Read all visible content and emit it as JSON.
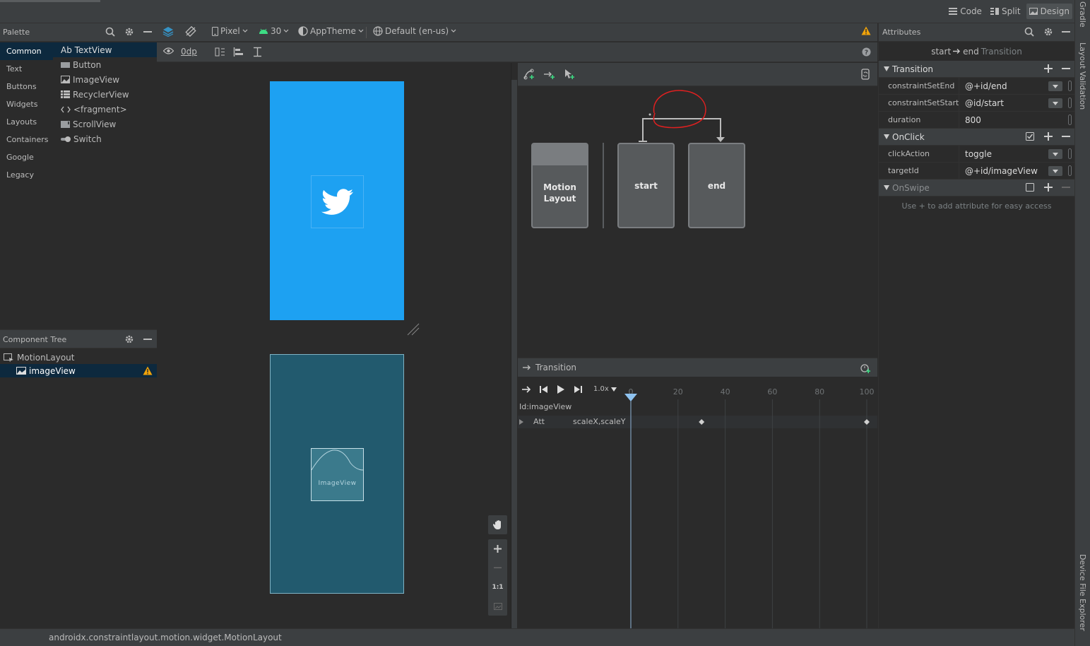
{
  "view_modes": [
    {
      "label": "Code",
      "icon": "lines-icon"
    },
    {
      "label": "Split",
      "icon": "split-icon"
    },
    {
      "label": "Design",
      "icon": "image-icon",
      "active": true
    }
  ],
  "right_stripe": {
    "gradle": "Gradle",
    "layout_validation": "Layout Validation",
    "device_file_explorer": "Device File Explorer"
  },
  "palette": {
    "title": "Palette",
    "categories": [
      "Common",
      "Text",
      "Buttons",
      "Widgets",
      "Layouts",
      "Containers",
      "Google",
      "Legacy"
    ],
    "active_category": "Common",
    "items": [
      "Ab TextView",
      "Button",
      "ImageView",
      "RecyclerView",
      "<fragment>",
      "ScrollView",
      "Switch"
    ]
  },
  "component_tree": {
    "title": "Component Tree",
    "nodes": [
      {
        "label": "MotionLayout"
      },
      {
        "label": "imageView",
        "warning": true
      }
    ]
  },
  "design_toolbar": {
    "device": "Pixel",
    "api": "30",
    "theme": "AppTheme",
    "locale": "Default (en-us)",
    "margin": "0dp"
  },
  "canvas": {
    "image_label": "ImageView"
  },
  "motion_editor": {
    "cards": [
      {
        "label": "Motion\nLayout"
      },
      {
        "label": "start"
      },
      {
        "label": "end"
      }
    ],
    "transition_title": "Transition",
    "speed": "1.0x",
    "ruler_ticks": [
      "0",
      "20",
      "40",
      "60",
      "80",
      "100"
    ],
    "timeline_id": "Id:imageView",
    "track_label": "Att",
    "track_attrs": "scaleX,scaleY",
    "keyframes": [
      30,
      100
    ]
  },
  "attributes": {
    "title": "Attributes",
    "subtitle_from": "start",
    "subtitle_to": "end",
    "subtitle_kind": "Transition",
    "sections": [
      {
        "name": "Transition",
        "rows": [
          {
            "key": "constraintSetEnd",
            "value": "@+id/end",
            "dropdown": true
          },
          {
            "key": "constraintSetStart",
            "value": "@id/start",
            "dropdown": true
          },
          {
            "key": "duration",
            "value": "800",
            "dropdown": false
          }
        ]
      },
      {
        "name": "OnClick",
        "rows": [
          {
            "key": "clickAction",
            "value": "toggle",
            "dropdown": true
          },
          {
            "key": "targetId",
            "value": "@+id/imageView",
            "dropdown": true
          }
        ]
      },
      {
        "name": "OnSwipe",
        "rows": []
      }
    ],
    "hint": "Use + to add attribute for easy access"
  },
  "status_bar": {
    "text": "androidx.constraintlayout.motion.widget.MotionLayout"
  },
  "colors": {
    "accent_blue": "#1da1f2",
    "preview_teal": "#225a6e",
    "selection": "#0d293e",
    "warning": "#f0a30a",
    "annotation_red": "#e02020"
  }
}
